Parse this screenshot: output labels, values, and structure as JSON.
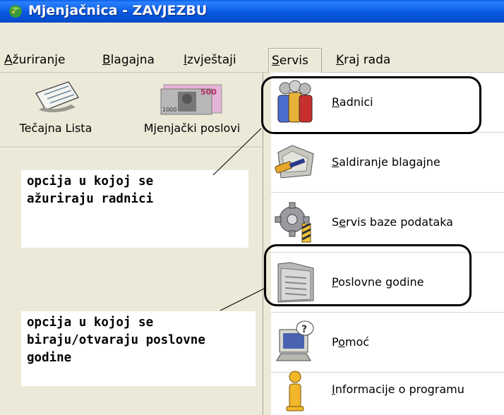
{
  "window": {
    "title": "Mjenjačnica - ZAVJEZBU"
  },
  "menu": [
    {
      "pre": "",
      "u": "A",
      "post": "žuriranje"
    },
    {
      "pre": "",
      "u": "B",
      "post": "lagajna"
    },
    {
      "pre": "",
      "u": "I",
      "post": "zvještaji"
    },
    {
      "pre": "",
      "u": "S",
      "post": "ervis",
      "active": true
    },
    {
      "pre": "",
      "u": "K",
      "post": "raj rada"
    }
  ],
  "toolbar": [
    {
      "label": "Tečajna Lista",
      "icon": "exchange-list-icon"
    },
    {
      "label": "Mjenjački poslovi",
      "icon": "banknote-icon"
    }
  ],
  "dropdown": [
    {
      "pre": "",
      "u": "R",
      "post": "adnici",
      "icon": "workers-icon"
    },
    {
      "pre": "",
      "u": "S",
      "post": "aldiranje blagajne",
      "icon": "cash-balance-icon"
    },
    {
      "pre": "S",
      "u": "e",
      "post": "rvis baze podataka",
      "icon": "database-service-icon"
    },
    {
      "pre": "",
      "u": "P",
      "post": "oslovne godine",
      "icon": "folder-icon"
    },
    {
      "pre": "P",
      "u": "o",
      "post": "moć",
      "icon": "help-computer-icon"
    },
    {
      "pre": "",
      "u": "I",
      "post": "nformacije o programu",
      "icon": "info-icon"
    }
  ],
  "notes": [
    {
      "lines": [
        "opcija u kojoj se",
        "ažuriraju radnici"
      ]
    },
    {
      "lines": [
        "opcija u kojoj se",
        "biraju/otvaraju poslovne",
        "godine"
      ]
    }
  ]
}
